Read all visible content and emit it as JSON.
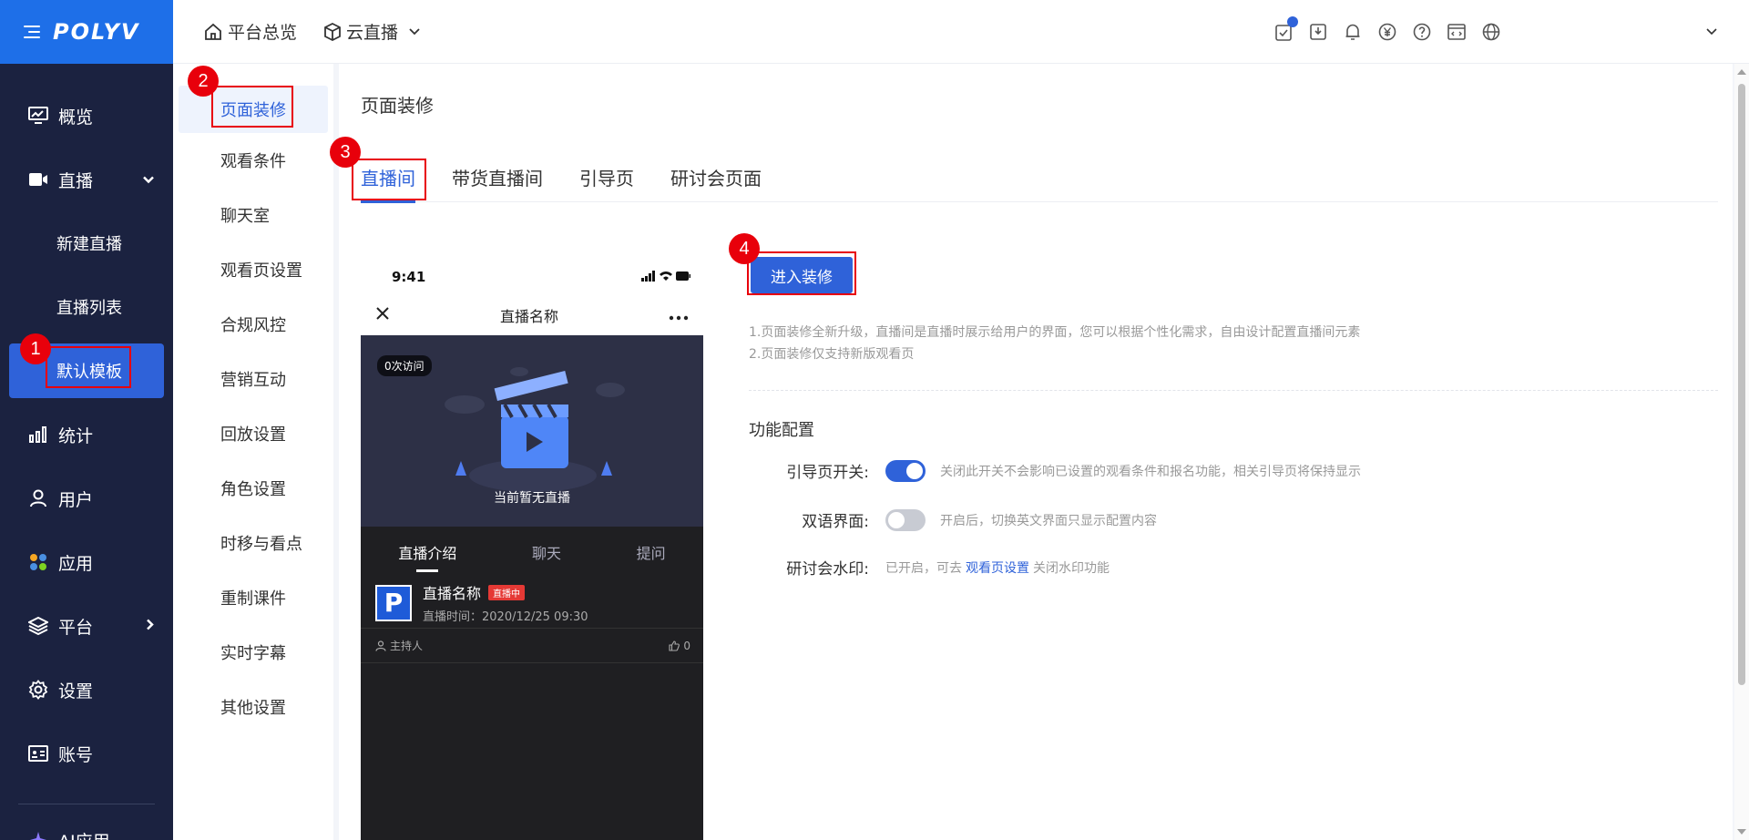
{
  "brand": {
    "logo": "POLYV",
    "color": "#1e6fe8"
  },
  "header": {
    "breadcrumb_home": "平台总览",
    "breadcrumb_product": "云直播"
  },
  "sidebar": {
    "items": [
      {
        "label": "概览",
        "icon": "monitor-icon"
      },
      {
        "label": "直播",
        "icon": "video-camera-icon"
      },
      {
        "label": "新建直播"
      },
      {
        "label": "直播列表"
      },
      {
        "label": "默认模板"
      },
      {
        "label": "统计",
        "icon": "bar-chart-icon"
      },
      {
        "label": "用户",
        "icon": "user-icon"
      },
      {
        "label": "应用",
        "icon": "apps-icon"
      },
      {
        "label": "平台",
        "icon": "layers-icon"
      },
      {
        "label": "设置",
        "icon": "gear-icon"
      },
      {
        "label": "账号",
        "icon": "id-card-icon"
      },
      {
        "label": "AI应用",
        "icon": "ai-icon"
      }
    ]
  },
  "subnav": {
    "items": [
      "页面装修",
      "观看条件",
      "聊天室",
      "观看页设置",
      "合规风控",
      "营销互动",
      "回放设置",
      "角色设置",
      "时移与看点",
      "重制课件",
      "实时字幕",
      "其他设置"
    ]
  },
  "main": {
    "title": "页面装修",
    "tabs": [
      "直播间",
      "带货直播间",
      "引导页",
      "研讨会页面"
    ],
    "enter_button": "进入装修",
    "tips": [
      "1.页面装修全新升级，直播间是直播时展示给用户的界面，您可以根据个性化需求，自由设计配置直播间元素",
      "2.页面装修仅支持新版观看页"
    ],
    "section_title": "功能配置",
    "config": {
      "guide_label": "引导页开关:",
      "guide_on": true,
      "guide_desc": "关闭此开关不会影响已设置的观看条件和报名功能，相关引导页将保持显示",
      "bilingual_label": "双语界面:",
      "bilingual_on": false,
      "bilingual_desc": "开启后，切换英文界面只显示配置内容",
      "watermark_label": "研讨会水印:",
      "watermark_prefix": "已开启，可去",
      "watermark_link": "观看页设置",
      "watermark_suffix": "关闭水印功能"
    }
  },
  "phone": {
    "time": "9:41",
    "title": "直播名称",
    "visits": "0次访问",
    "no_live": "当前暂无直播",
    "tabs": [
      "直播介绍",
      "聊天",
      "提问"
    ],
    "live_name": "直播名称",
    "live_status": "直播中",
    "live_time": "直播时间：2020/12/25 09:30",
    "host": "主持人",
    "likes": "0"
  },
  "annotations": [
    "1",
    "2",
    "3",
    "4"
  ],
  "colors": {
    "accent": "#2f62d9",
    "sidebar_bg": "#1b2240",
    "annotation_red": "#e8000b"
  }
}
